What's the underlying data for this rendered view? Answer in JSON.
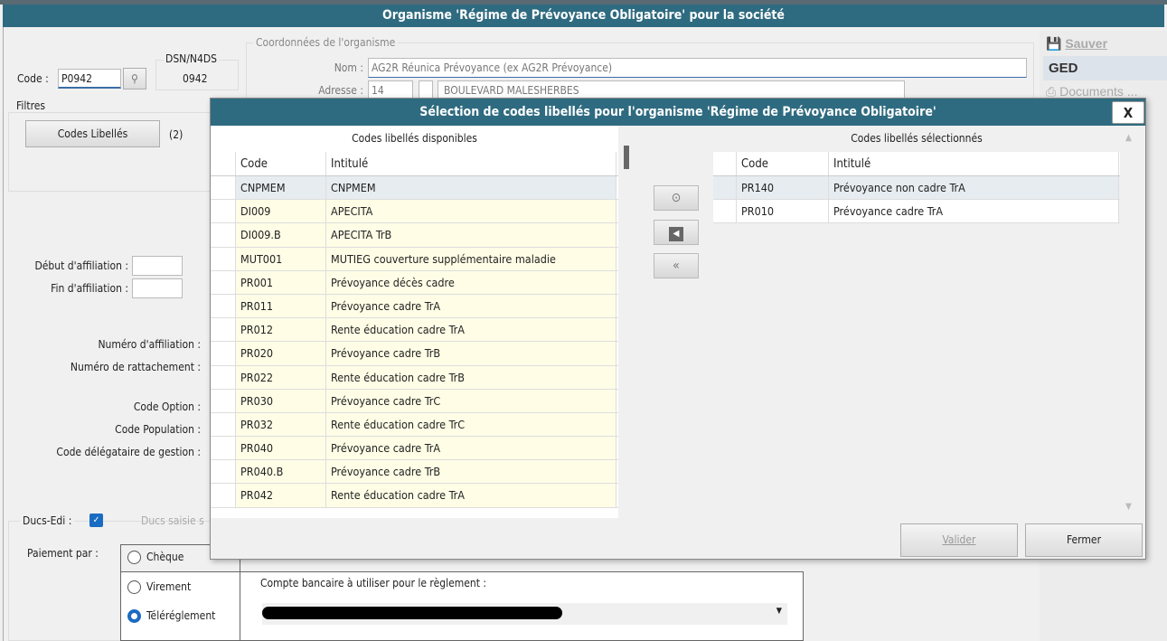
{
  "window": {
    "title": "Organisme 'Régime de Prévoyance Obligatoire' pour la société"
  },
  "form": {
    "code_label": "Code :",
    "code_value": "P0942",
    "dsn_label": "DSN/N4DS",
    "dsn_value": "0942",
    "coord_group": "Coordonnées de l'organisme",
    "nom_label": "Nom :",
    "nom_value": "AG2R Réunica Prévoyance (ex AG2R Prévoyance)",
    "adresse_label": "Adresse :",
    "adresse_num": "14",
    "adresse_rue": "BOULEVARD MALESHERBES",
    "filtres_label": "Filtres",
    "codes_libelles_button": "Codes Libellés",
    "codes_libelles_count": "(2)",
    "debut_label": "Début d'affiliation :",
    "fin_label": "Fin d'affiliation :",
    "num_affiliation_label": "Numéro d'affiliation :",
    "num_rattachement_label": "Numéro de rattachement :",
    "code_option_label": "Code Option :",
    "code_population_label": "Code Population :",
    "code_delegataire_label": "Code délégataire de gestion :",
    "ducs_edi_label": "Ducs-Edi :",
    "ducs_edi_checked": true,
    "ducs_saisie_label": "Ducs saisie s",
    "paiement_label": "Paiement par :",
    "paiement_options": [
      "Chèque",
      "Virement",
      "Téléréglement"
    ],
    "paiement_selected": "Téléréglement",
    "compte_label": "Compte bancaire à utiliser pour le règlement :"
  },
  "sidebar": {
    "items": [
      {
        "label": "Sauver",
        "icon": "save-icon"
      },
      {
        "label": "GED"
      },
      {
        "label": "Documents ...",
        "icon": "printer-icon"
      }
    ]
  },
  "dialog": {
    "title": "Sélection de codes libellés pour l'organisme 'Régime de Prévoyance Obligatoire'",
    "close_label": "X",
    "available_title": "Codes libellés disponibles",
    "selected_title": "Codes libellés sélectionnés",
    "col_code": "Code",
    "col_intitule": "Intitulé",
    "available": [
      {
        "code": "CNPMEM",
        "label": "CNPMEM"
      },
      {
        "code": "DI009",
        "label": "APECITA"
      },
      {
        "code": "DI009.B",
        "label": "APECITA TrB"
      },
      {
        "code": "MUT001",
        "label": "MUTIEG couverture supplémentaire maladie"
      },
      {
        "code": "PR001",
        "label": "Prévoyance décès cadre"
      },
      {
        "code": "PR011",
        "label": "Prévoyance cadre TrA"
      },
      {
        "code": "PR012",
        "label": "Rente éducation cadre TrA"
      },
      {
        "code": "PR020",
        "label": "Prévoyance cadre TrB"
      },
      {
        "code": "PR022",
        "label": "Rente éducation cadre TrB"
      },
      {
        "code": "PR030",
        "label": "Prévoyance cadre TrC"
      },
      {
        "code": "PR032",
        "label": "Rente éducation cadre TrC"
      },
      {
        "code": "PR040",
        "label": "Prévoyance cadre TrA"
      },
      {
        "code": "PR040.B",
        "label": "Prévoyance cadre TrB"
      },
      {
        "code": "PR042",
        "label": "Rente éducation cadre TrA"
      }
    ],
    "selected": [
      {
        "code": "PR140",
        "label": "Prévoyance non cadre TrA"
      },
      {
        "code": "PR010",
        "label": "Prévoyance cadre TrA"
      }
    ],
    "add_icon": "play-circle-icon",
    "remove_icon": "arrow-left-icon",
    "remove_all_label": "«",
    "valider_label": "Valider",
    "fermer_label": "Fermer"
  }
}
